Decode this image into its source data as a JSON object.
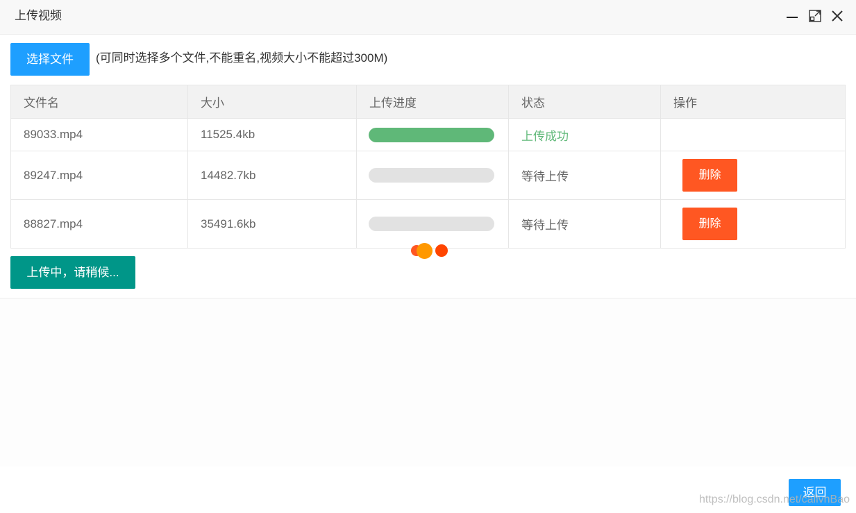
{
  "window": {
    "title": "上传视频"
  },
  "toolbar": {
    "select_label": "选择文件",
    "hint": "(可同时选择多个文件,不能重名,视频大小不能超过300M)"
  },
  "table": {
    "headers": [
      "文件名",
      "大小",
      "上传进度",
      "状态",
      "操作"
    ],
    "rows": [
      {
        "name": "89033.mp4",
        "size": "11525.4kb",
        "progress": 1.0,
        "status": "上传成功",
        "action": ""
      },
      {
        "name": "89247.mp4",
        "size": "14482.7kb",
        "progress": 0.0,
        "status": "等待上传",
        "action": "删除"
      },
      {
        "name": "88827.mp4",
        "size": "35491.6kb",
        "progress": 0.0,
        "status": "等待上传",
        "action": "删除"
      }
    ]
  },
  "uploading_label": "上传中，请稍候...",
  "back_label": "返回",
  "watermark": "https://blog.csdn.net/callvnBao",
  "colors": {
    "primary": "#1e9fff",
    "success": "#5fb878",
    "danger": "#ff5722",
    "teal": "#009688",
    "loader_dots": [
      "#ff5722",
      "#ff9800",
      "#ff4500"
    ]
  },
  "icons": [
    "minimize-icon",
    "maximize-icon",
    "close-icon"
  ]
}
